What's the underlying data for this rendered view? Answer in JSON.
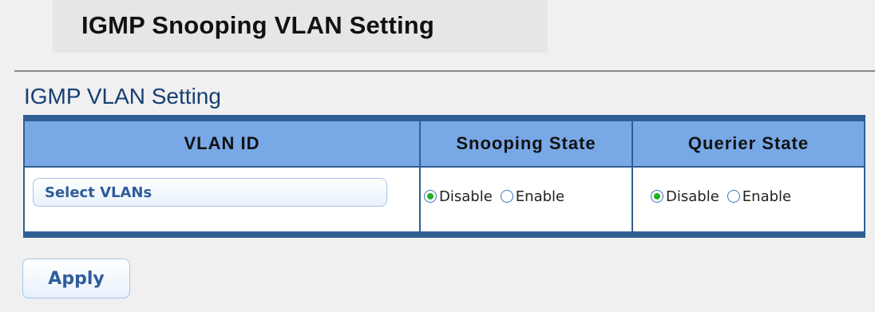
{
  "page": {
    "title": "IGMP Snooping VLAN Setting",
    "section_title": "IGMP VLAN Setting"
  },
  "table": {
    "headers": [
      "VLAN ID",
      "Snooping State",
      "Querier State"
    ],
    "row": {
      "vlan_button_label": "Select VLANs",
      "snooping_state": {
        "selected": "Disable",
        "options": [
          "Disable",
          "Enable"
        ]
      },
      "querier_state": {
        "selected": "Disable",
        "options": [
          "Disable",
          "Enable"
        ]
      }
    }
  },
  "actions": {
    "apply_label": "Apply"
  },
  "colors": {
    "background": "#f0f0f0",
    "title_band": "#e6e6e6",
    "table_border": "#2f5f93",
    "header_fill": "#78a8e6",
    "section_title": "#163f73",
    "button_text": "#2f5d9a",
    "radio_checked": "#1fb11f"
  }
}
